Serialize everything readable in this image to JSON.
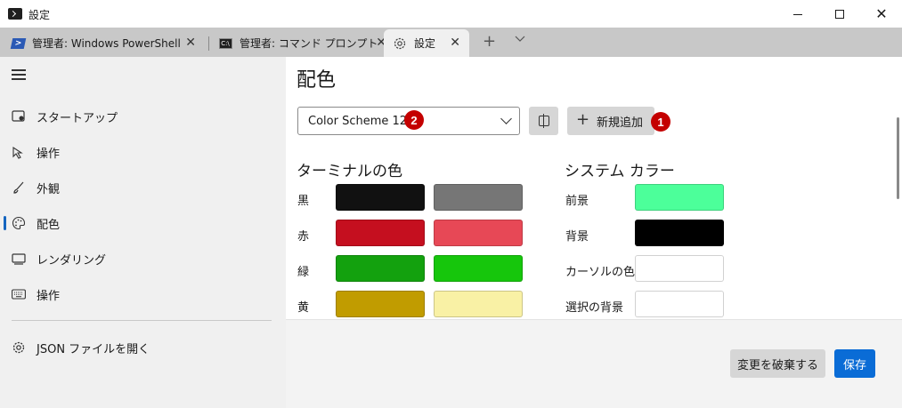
{
  "window": {
    "title": "設定",
    "minimize": "minimize",
    "maximize": "maximize",
    "close": "✕"
  },
  "tabs": [
    {
      "label": "管理者: Windows PowerShell",
      "icon": "powershell-icon",
      "close": "✕"
    },
    {
      "label": "管理者: コマンド プロンプト",
      "icon": "cmd-icon",
      "close": "✕"
    },
    {
      "label": "設定",
      "icon": "gear-icon",
      "close": "✕"
    }
  ],
  "tabstrip": {
    "new_tab": "+",
    "dropdown": "⌵"
  },
  "sidebar": {
    "items": [
      {
        "label": "スタートアップ",
        "icon": "startup-icon"
      },
      {
        "label": "操作",
        "icon": "interaction-icon"
      },
      {
        "label": "外観",
        "icon": "brush-icon"
      },
      {
        "label": "配色",
        "icon": "palette-icon",
        "selected": true
      },
      {
        "label": "レンダリング",
        "icon": "monitor-icon"
      },
      {
        "label": "操作",
        "icon": "keyboard-icon"
      }
    ],
    "json_item": {
      "label": "JSON ファイルを開く",
      "icon": "gear-icon"
    }
  },
  "main": {
    "title": "配色",
    "scheme_select": {
      "value": "Color Scheme 12"
    },
    "rename_button_icon": "rename-icon",
    "add_button": {
      "label": "新規追加",
      "icon": "+"
    },
    "badges": {
      "select": "2",
      "add": "1"
    },
    "terminal_colors": {
      "title": "ターミナルの色",
      "rows": [
        {
          "label": "黒",
          "normal": "#111111",
          "bright": "#767676"
        },
        {
          "label": "赤",
          "normal": "#c50f1f",
          "bright": "#e74856"
        },
        {
          "label": "緑",
          "normal": "#13a10e",
          "bright": "#16c60c"
        },
        {
          "label": "黄",
          "normal": "#c19c00",
          "bright": "#f9f1a5"
        }
      ]
    },
    "system_colors": {
      "title": "システム カラー",
      "rows": [
        {
          "label": "前景",
          "color": "#4cff9a"
        },
        {
          "label": "背景",
          "color": "#000000"
        },
        {
          "label": "カーソルの色",
          "color": "#ffffff"
        },
        {
          "label": "選択の背景",
          "color": "#ffffff"
        }
      ]
    }
  },
  "footer": {
    "discard_label": "変更を破棄する",
    "save_label": "保存"
  },
  "colors": {
    "accent": "#0a6cd6",
    "badge": "#c40000",
    "sidebar_bg": "#f0f0f0",
    "tabstrip_bg": "#c8c8c8"
  }
}
